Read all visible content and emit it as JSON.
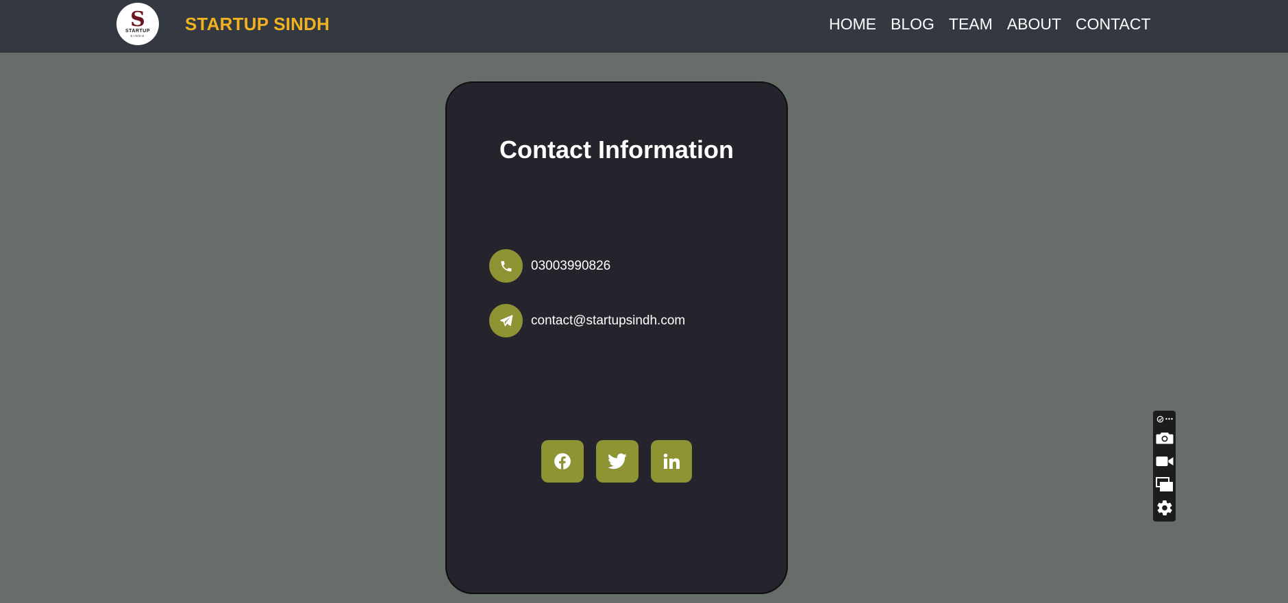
{
  "header": {
    "logo": {
      "mark": "S",
      "line1": "STARTUP",
      "line2": "SINDH"
    },
    "brand": "STARTUP SINDH",
    "nav": [
      "HOME",
      "BLOG",
      "TEAM",
      "ABOUT",
      "CONTACT"
    ]
  },
  "contact_card": {
    "title": "Contact Information",
    "phone": {
      "icon": "phone-icon",
      "value": "03003990826"
    },
    "email": {
      "icon": "paper-plane-icon",
      "value": "contact@startupsindh.com"
    },
    "socials": [
      "facebook-icon",
      "twitter-icon",
      "linkedin-icon"
    ]
  },
  "side_toolbar": {
    "icons": [
      "extension-icon",
      "more-icon",
      "camera-icon",
      "video-icon",
      "screens-icon",
      "gear-icon"
    ]
  },
  "colors": {
    "page_bg": "#676e69",
    "navbar_bg": "#343841",
    "brand": "#f1b21f",
    "card_bg": "#25232b",
    "accent": "#8e9334"
  }
}
